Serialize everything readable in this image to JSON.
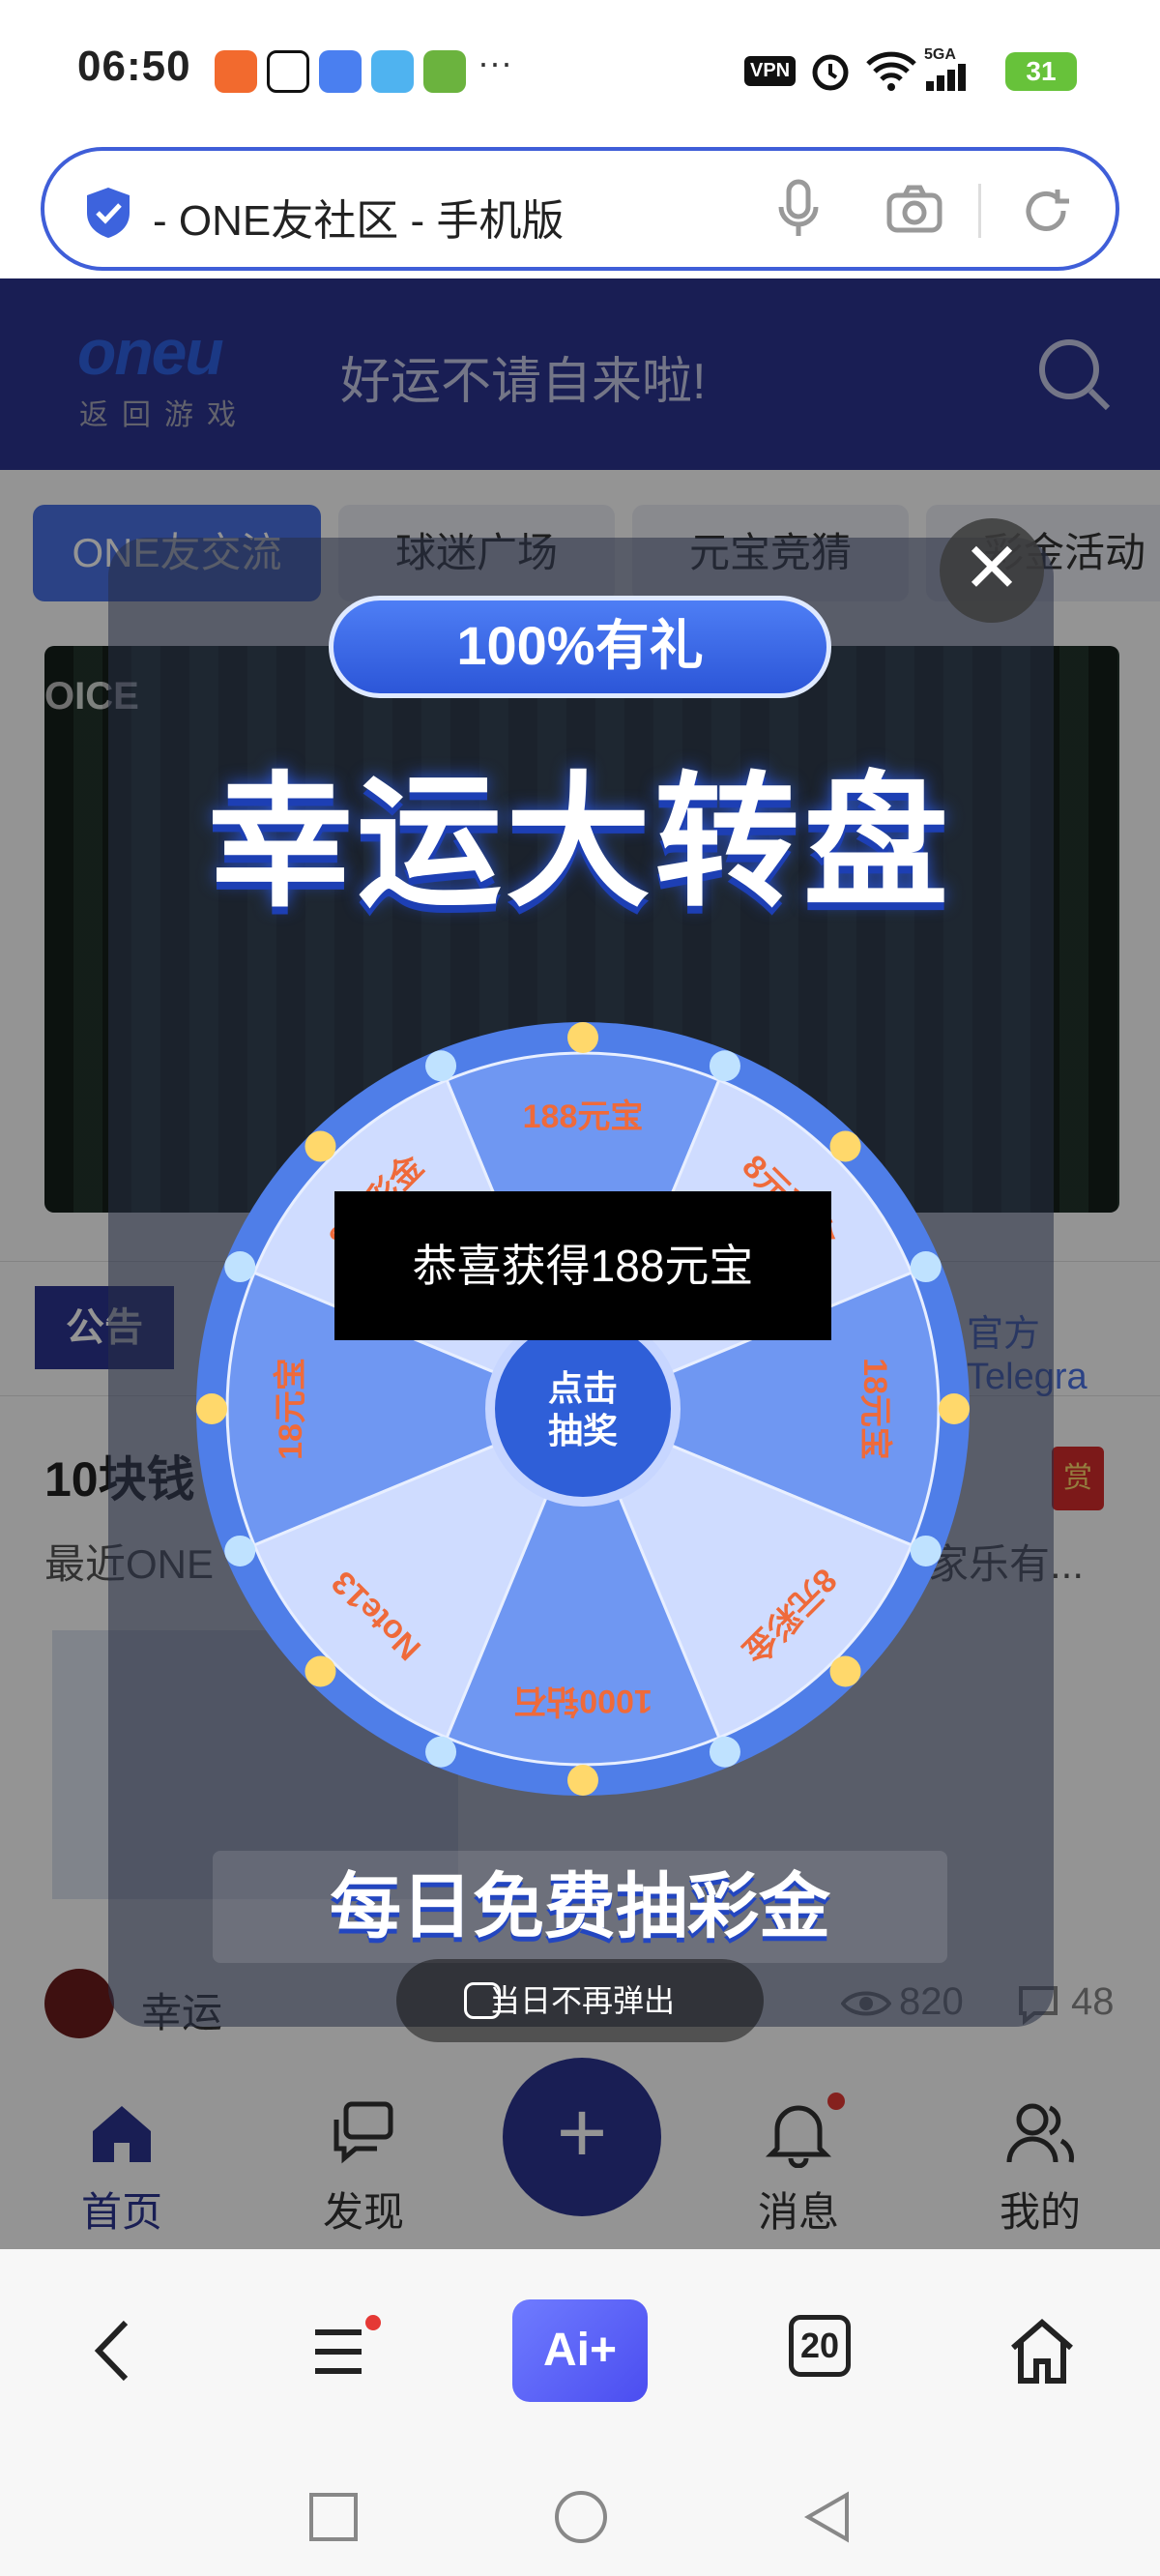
{
  "status": {
    "time": "06:50",
    "more": "···",
    "vpn": "VPN",
    "network": "5GA",
    "battery": "31"
  },
  "browser": {
    "url_title": "- ONE友社区 - 手机版",
    "tab_count": "20",
    "ai_label": "Ai+"
  },
  "site": {
    "logo": "oneu",
    "logo_sub": "返回游戏",
    "header_title": "好运不请自来啦!"
  },
  "tabs": [
    "ONE友交流",
    "球迷广场",
    "元宝竞猜",
    "彩金活动"
  ],
  "notice": {
    "tag": "公告",
    "right_text": "官方Telegra"
  },
  "post": {
    "title": "10块钱",
    "desc_left": "最近ONE",
    "desc_right": "家乐有...",
    "author": "幸运",
    "views": "820",
    "comments": "48",
    "reward": "赏"
  },
  "appnav": {
    "home": "首页",
    "discover": "发现",
    "messages": "消息",
    "mine": "我的"
  },
  "popup": {
    "badge": "100%有礼",
    "title": "幸运大转盘",
    "center_btn": "点击\n抽奖",
    "prizes": [
      "188元宝",
      "8元彩金",
      "18元宝",
      "8元彩金",
      "1000钻石",
      "Note13",
      "18元宝",
      "8元彩金"
    ],
    "toast": "恭喜获得188元宝",
    "daily": "每日免费抽彩金",
    "dont_show": "当日不再弹出"
  }
}
